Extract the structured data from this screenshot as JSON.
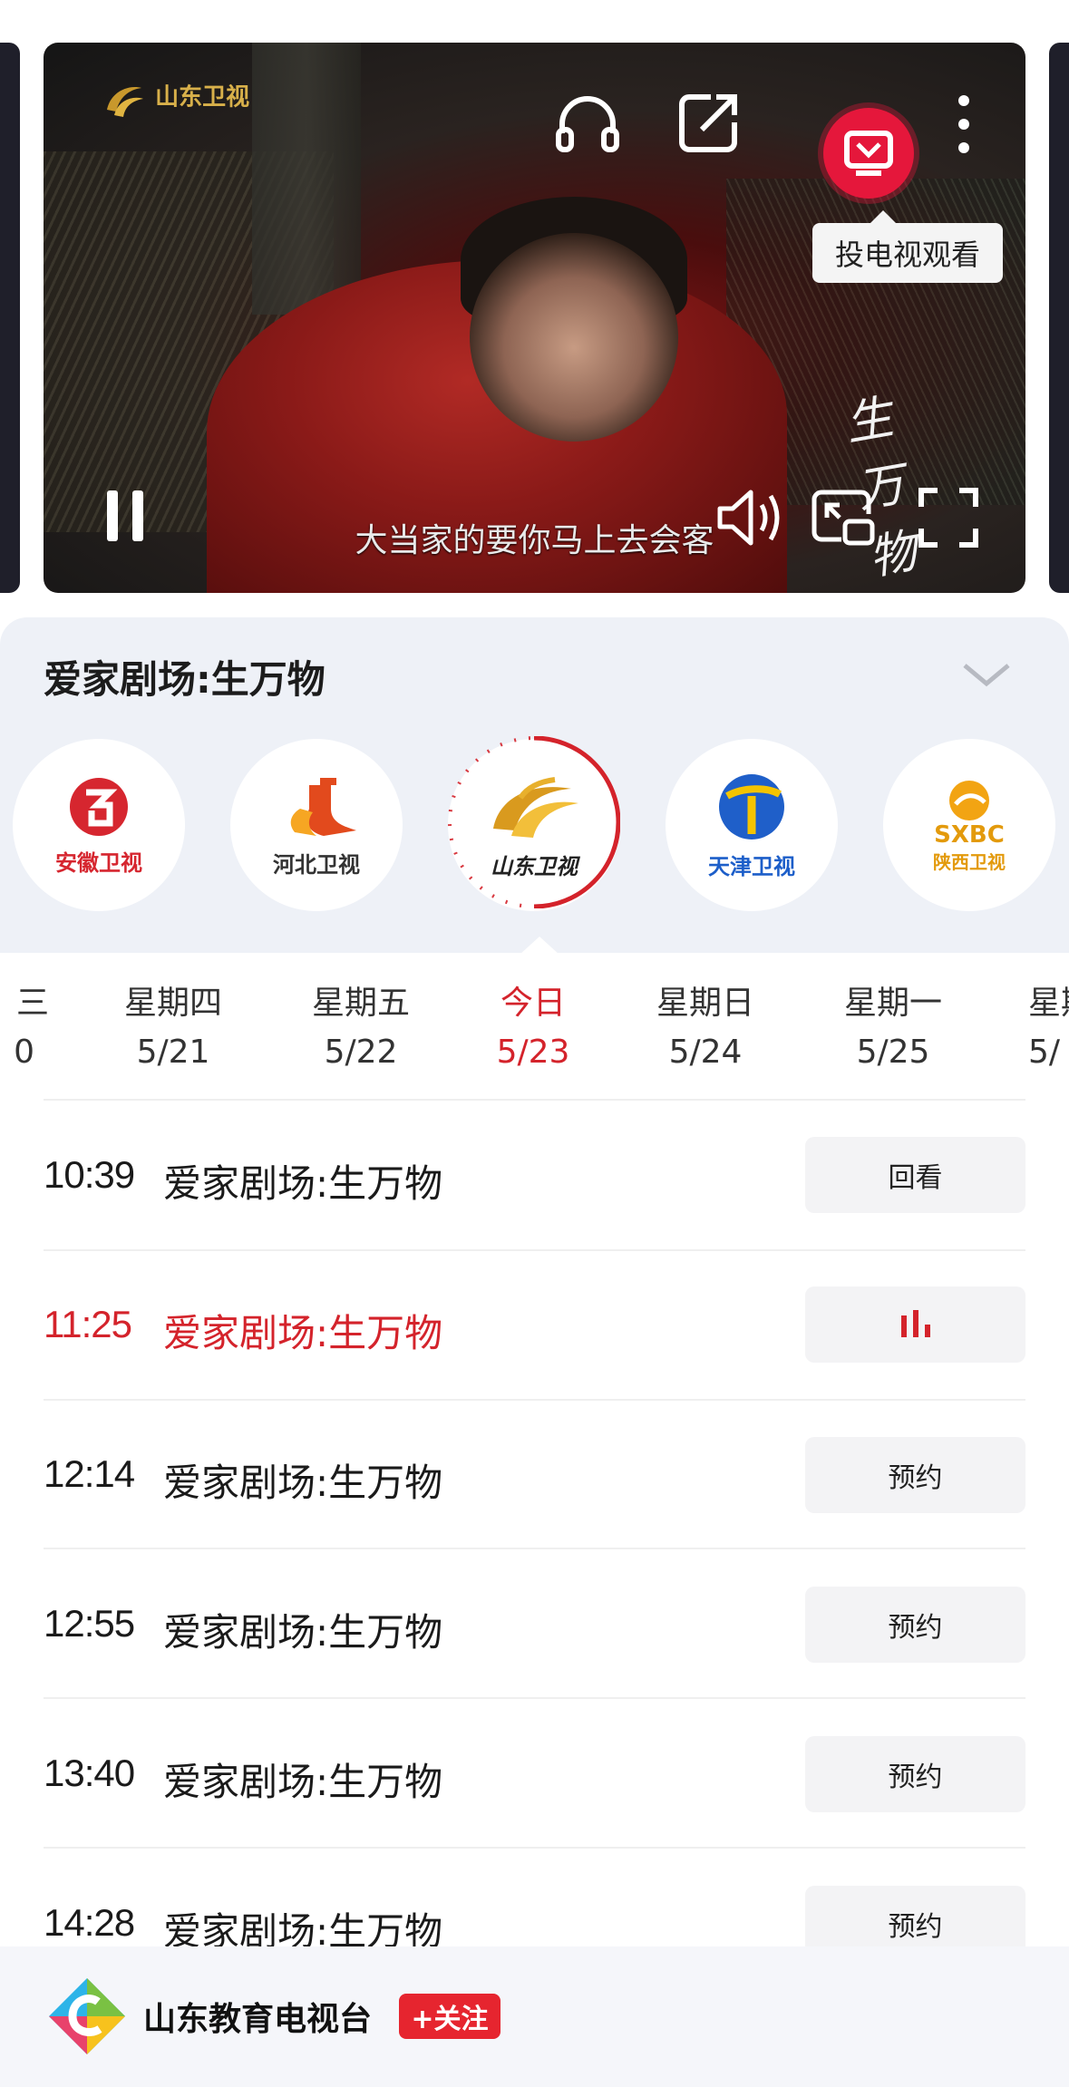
{
  "video": {
    "channel_watermark": "山东卫视",
    "subtitle": "大当家的要你马上去会客",
    "title_watermark": "生万物",
    "cast_tooltip": "投电视观看",
    "icons": [
      "headphones-icon",
      "share-icon",
      "tv-cast-icon",
      "more-icon",
      "pause-icon",
      "volume-icon",
      "pip-icon",
      "fullscreen-icon"
    ]
  },
  "panel": {
    "title": "爱家剧场:生万物",
    "channels": [
      {
        "name": "安徽卫视",
        "color": "#d6262f"
      },
      {
        "name": "河北卫视",
        "color": "#333333"
      },
      {
        "name": "山东卫视",
        "color": "#222222",
        "active": true
      },
      {
        "name": "天津卫视",
        "color": "#1c5ec9"
      },
      {
        "name": "陕西卫视",
        "color": "#e39a0c",
        "sub": "SXBC"
      }
    ]
  },
  "dates": [
    {
      "day": "三",
      "date": "0"
    },
    {
      "day": "星期四",
      "date": "5/21"
    },
    {
      "day": "星期五",
      "date": "5/22"
    },
    {
      "day": "今日",
      "date": "5/23",
      "active": true
    },
    {
      "day": "星期日",
      "date": "5/24"
    },
    {
      "day": "星期一",
      "date": "5/25"
    },
    {
      "day": "星期",
      "date": "5/"
    }
  ],
  "schedule": [
    {
      "time": "10:39",
      "title": "爱家剧场:生万物",
      "action": "回看"
    },
    {
      "time": "11:25",
      "title": "爱家剧场:生万物",
      "action": "",
      "live": true
    },
    {
      "time": "12:14",
      "title": "爱家剧场:生万物",
      "action": "预约"
    },
    {
      "time": "12:55",
      "title": "爱家剧场:生万物",
      "action": "预约"
    },
    {
      "time": "13:40",
      "title": "爱家剧场:生万物",
      "action": "预约"
    },
    {
      "time": "14:28",
      "title": "爱家剧场:生万物",
      "action": "预约"
    }
  ],
  "footer": {
    "account_name": "山东教育电视台",
    "follow_label": "+关注"
  },
  "colors": {
    "accent_red": "#d4232b",
    "panel_bg": "#eef1f7"
  }
}
